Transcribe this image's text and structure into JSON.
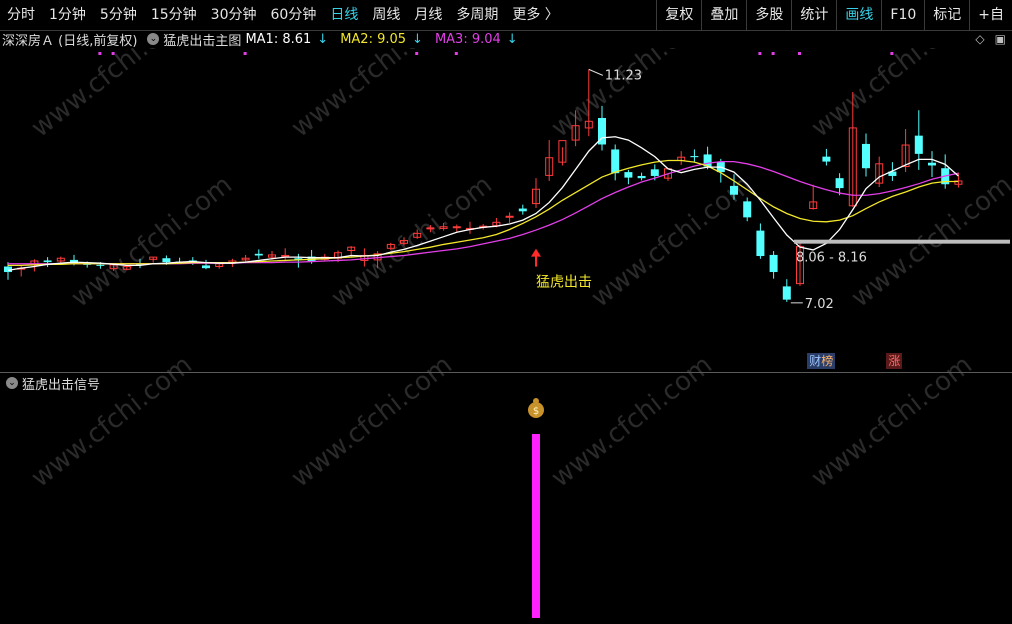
{
  "toolbar": {
    "periods": [
      "分时",
      "1分钟",
      "5分钟",
      "15分钟",
      "30分钟",
      "60分钟",
      "日线",
      "周线",
      "月线",
      "多周期",
      "更多 〉"
    ],
    "active_period": "日线",
    "tools": [
      "复权",
      "叠加",
      "多股",
      "统计",
      "画线",
      "F10",
      "标记",
      "+自"
    ],
    "active_tool": "画线"
  },
  "infobar": {
    "stock": "深深房Ａ (日线,前复权)",
    "indicator": "猛虎出击主图",
    "ma1": "MA1: 8.61",
    "ma2": "MA2: 9.05",
    "ma3": "MA3: 9.04"
  },
  "annotations": {
    "high_label": "11.23",
    "low_label": "7.02",
    "range_label": "8.06 - 8.16",
    "signal_label": "猛虎出击",
    "tag_cai": "财",
    "tag_bang": "榜",
    "tag_zhang": "涨"
  },
  "sub": {
    "title": "猛虎出击信号"
  },
  "watermark": "www.cfchi.com",
  "colors": {
    "up": "#ff3b3b",
    "down": "#54ffff",
    "ma1": "#ffffff",
    "ma2": "#f2e72a",
    "ma3": "#e23fe8",
    "signal": "#ff22ff",
    "accent": "#36d1e8"
  },
  "chart_data": {
    "type": "candlestick",
    "price_range": [
      6.8,
      11.4
    ],
    "candles": [
      [
        7.66,
        7.74,
        7.56,
        7.42
      ],
      [
        7.62,
        7.68,
        7.63,
        7.48
      ],
      [
        7.7,
        7.79,
        7.76,
        7.57
      ],
      [
        7.77,
        7.83,
        7.74,
        7.65
      ],
      [
        7.76,
        7.84,
        7.81,
        7.7
      ],
      [
        7.78,
        7.87,
        7.71,
        7.68
      ],
      [
        7.73,
        7.75,
        7.69,
        7.64
      ],
      [
        7.69,
        7.74,
        7.68,
        7.62
      ],
      [
        7.62,
        7.71,
        7.69,
        7.58
      ],
      [
        7.61,
        7.68,
        7.66,
        7.59
      ],
      [
        7.7,
        7.8,
        7.68,
        7.63
      ],
      [
        7.79,
        7.83,
        7.83,
        7.73
      ],
      [
        7.81,
        7.86,
        7.74,
        7.69
      ],
      [
        7.75,
        7.82,
        7.74,
        7.71
      ],
      [
        7.77,
        7.83,
        7.76,
        7.69
      ],
      [
        7.68,
        7.78,
        7.63,
        7.61
      ],
      [
        7.66,
        7.73,
        7.71,
        7.62
      ],
      [
        7.72,
        7.8,
        7.76,
        7.65
      ],
      [
        7.78,
        7.87,
        7.81,
        7.74
      ],
      [
        7.89,
        7.97,
        7.86,
        7.8
      ],
      [
        7.83,
        7.94,
        7.87,
        7.78
      ],
      [
        7.84,
        7.99,
        7.86,
        7.78
      ],
      [
        7.81,
        7.89,
        7.78,
        7.64
      ],
      [
        7.84,
        7.96,
        7.75,
        7.71
      ],
      [
        7.79,
        7.89,
        7.83,
        7.76
      ],
      [
        7.81,
        7.95,
        7.91,
        7.74
      ],
      [
        7.95,
        8.03,
        8.01,
        7.83
      ],
      [
        7.77,
        7.99,
        7.86,
        7.66
      ],
      [
        7.78,
        7.94,
        7.89,
        7.63
      ],
      [
        7.99,
        8.09,
        8.06,
        7.96
      ],
      [
        8.08,
        8.19,
        8.13,
        8.04
      ],
      [
        8.19,
        8.33,
        8.26,
        8.16
      ],
      [
        8.35,
        8.41,
        8.36,
        8.28
      ],
      [
        8.35,
        8.45,
        8.38,
        8.31
      ],
      [
        8.38,
        8.42,
        8.38,
        8.29
      ],
      [
        8.34,
        8.47,
        8.35,
        8.25
      ],
      [
        8.37,
        8.43,
        8.39,
        8.33
      ],
      [
        8.4,
        8.54,
        8.46,
        8.37
      ],
      [
        8.56,
        8.64,
        8.57,
        8.45
      ],
      [
        8.71,
        8.78,
        8.66,
        8.6
      ],
      [
        8.8,
        9.26,
        9.06,
        8.72
      ],
      [
        9.31,
        9.95,
        9.63,
        9.21
      ],
      [
        9.55,
        9.82,
        9.94,
        9.49
      ],
      [
        9.95,
        10.49,
        10.21,
        9.84
      ],
      [
        10.17,
        11.23,
        10.29,
        10.02
      ],
      [
        10.35,
        10.57,
        9.87,
        9.76
      ],
      [
        9.78,
        9.87,
        9.35,
        9.22
      ],
      [
        9.37,
        9.41,
        9.27,
        9.15
      ],
      [
        9.3,
        9.36,
        9.26,
        9.22
      ],
      [
        9.42,
        9.51,
        9.3,
        9.22
      ],
      [
        9.26,
        9.35,
        9.43,
        9.21
      ],
      [
        9.58,
        9.75,
        9.64,
        9.5
      ],
      [
        9.66,
        9.78,
        9.64,
        9.56
      ],
      [
        9.69,
        9.83,
        9.47,
        9.42
      ],
      [
        9.56,
        9.61,
        9.37,
        9.18
      ],
      [
        9.12,
        9.33,
        8.96,
        8.87
      ],
      [
        8.84,
        8.91,
        8.55,
        8.48
      ],
      [
        8.31,
        8.44,
        7.85,
        7.8
      ],
      [
        7.87,
        7.94,
        7.56,
        7.44
      ],
      [
        7.3,
        7.43,
        7.06,
        7.02
      ],
      [
        7.35,
        8.14,
        8.02,
        7.31
      ],
      [
        8.71,
        9.14,
        8.83,
        8.69
      ],
      [
        9.65,
        9.79,
        9.56,
        9.49
      ],
      [
        9.26,
        9.35,
        9.08,
        8.95
      ],
      [
        8.76,
        10.82,
        10.17,
        8.74
      ],
      [
        9.88,
        10.07,
        9.44,
        9.29
      ],
      [
        9.17,
        9.65,
        9.52,
        9.1
      ],
      [
        9.38,
        9.55,
        9.3,
        9.21
      ],
      [
        9.47,
        10.15,
        9.86,
        9.37
      ],
      [
        10.03,
        10.49,
        9.7,
        9.41
      ],
      [
        9.54,
        9.75,
        9.49,
        9.28
      ],
      [
        9.44,
        9.69,
        9.15,
        9.07
      ],
      [
        9.15,
        9.36,
        9.21,
        9.09
      ]
    ],
    "ma1": [
      7.59,
      7.63,
      7.66,
      7.7,
      7.72,
      7.74,
      7.73,
      7.72,
      7.7,
      7.68,
      7.68,
      7.71,
      7.72,
      7.74,
      7.75,
      7.73,
      7.72,
      7.72,
      7.74,
      7.77,
      7.8,
      7.83,
      7.83,
      7.82,
      7.82,
      7.82,
      7.86,
      7.85,
      7.86,
      7.92,
      7.97,
      8.04,
      8.12,
      8.2,
      8.28,
      8.33,
      8.37,
      8.39,
      8.43,
      8.5,
      8.62,
      8.82,
      9.09,
      9.42,
      9.75,
      9.99,
      10.01,
      9.95,
      9.81,
      9.65,
      9.43,
      9.36,
      9.42,
      9.46,
      9.46,
      9.37,
      9.15,
      8.86,
      8.54,
      8.23,
      8.01,
      7.96,
      8.08,
      8.33,
      8.69,
      9.07,
      9.28,
      9.39,
      9.5,
      9.6,
      9.6,
      9.51,
      9.3
    ],
    "ma2": [
      7.68,
      7.68,
      7.69,
      7.7,
      7.7,
      7.71,
      7.71,
      7.71,
      7.71,
      7.71,
      7.71,
      7.71,
      7.71,
      7.72,
      7.73,
      7.73,
      7.73,
      7.73,
      7.74,
      7.75,
      7.76,
      7.77,
      7.78,
      7.79,
      7.8,
      7.82,
      7.83,
      7.85,
      7.87,
      7.9,
      7.93,
      7.97,
      8.01,
      8.06,
      8.1,
      8.14,
      8.18,
      8.24,
      8.33,
      8.44,
      8.56,
      8.7,
      8.86,
      9.0,
      9.14,
      9.28,
      9.37,
      9.44,
      9.5,
      9.55,
      9.58,
      9.58,
      9.55,
      9.48,
      9.36,
      9.21,
      9.05,
      8.89,
      8.74,
      8.62,
      8.53,
      8.48,
      8.47,
      8.5,
      8.58,
      8.71,
      8.83,
      8.93,
      9.01,
      9.1,
      9.17,
      9.2,
      9.2
    ],
    "ma3": [
      7.71,
      7.71,
      7.71,
      7.71,
      7.71,
      7.71,
      7.71,
      7.71,
      7.71,
      7.71,
      7.71,
      7.71,
      7.71,
      7.71,
      7.72,
      7.72,
      7.72,
      7.72,
      7.73,
      7.73,
      7.73,
      7.74,
      7.74,
      7.75,
      7.76,
      7.77,
      7.78,
      7.8,
      7.82,
      7.84,
      7.86,
      7.89,
      7.92,
      7.95,
      7.98,
      8.02,
      8.07,
      8.12,
      8.17,
      8.24,
      8.32,
      8.41,
      8.51,
      8.63,
      8.76,
      8.89,
      9.0,
      9.1,
      9.19,
      9.26,
      9.34,
      9.41,
      9.48,
      9.53,
      9.56,
      9.56,
      9.52,
      9.46,
      9.38,
      9.29,
      9.2,
      9.12,
      9.05,
      8.99,
      8.95,
      8.95,
      8.98,
      9.03,
      9.09,
      9.16,
      9.24,
      9.3,
      9.35
    ],
    "signal_index": 40,
    "tag_positions": {
      "cai_index": 61,
      "zhang_index": 67
    },
    "range_line": {
      "index_start": 60,
      "value": 8.11
    }
  }
}
